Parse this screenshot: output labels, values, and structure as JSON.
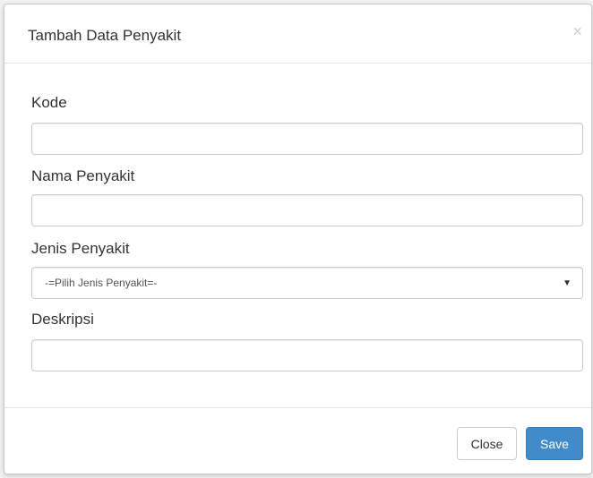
{
  "modal": {
    "title": "Tambah Data Penyakit",
    "close_glyph": "×"
  },
  "form": {
    "kode": {
      "label": "Kode",
      "value": ""
    },
    "nama": {
      "label": "Nama Penyakit",
      "value": ""
    },
    "jenis": {
      "label": "Jenis Penyakit",
      "selected": "-=Pilih Jenis Penyakit=-"
    },
    "deskripsi": {
      "label": "Deskripsi",
      "value": ""
    }
  },
  "footer": {
    "close_label": "Close",
    "save_label": "Save"
  },
  "icons": {
    "close": "close-icon",
    "select_caret": "caret-down-icon"
  },
  "colors": {
    "primary": "#428bca",
    "border": "#cccccc",
    "text": "#333333"
  }
}
